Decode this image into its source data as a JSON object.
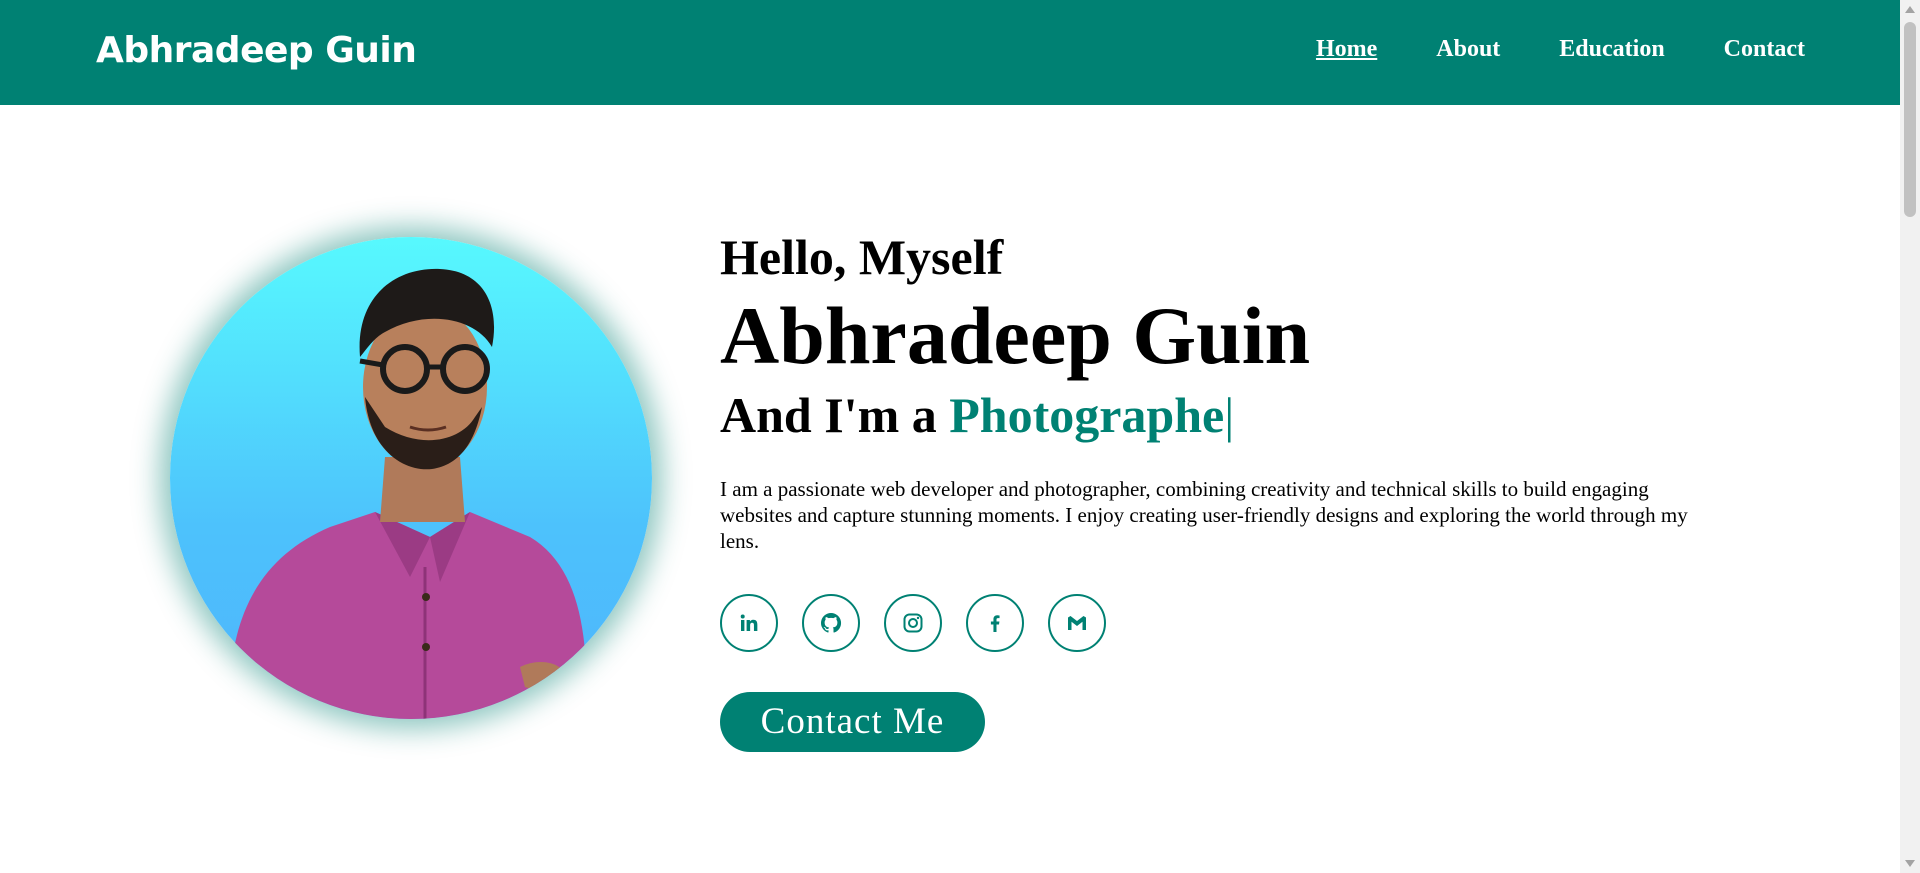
{
  "header": {
    "logo": "Abhradeep Guin",
    "nav": [
      {
        "label": "Home",
        "active": true
      },
      {
        "label": "About",
        "active": false
      },
      {
        "label": "Education",
        "active": false
      },
      {
        "label": "Contact",
        "active": false
      }
    ]
  },
  "hero": {
    "greeting": "Hello, Myself",
    "name": "Abhradeep Guin",
    "role_prefix": "And I'm a ",
    "role_typed": "Photographe",
    "caret": "|",
    "bio": "I am a passionate web developer and photographer, combining creativity and technical skills to build engaging websites and capture stunning moments. I enjoy creating user-friendly designs and exploring the world through my lens.",
    "socials": [
      "linkedin-icon",
      "github-icon",
      "instagram-icon",
      "facebook-icon",
      "gmail-icon"
    ],
    "contact_button": "Contact Me"
  },
  "colors": {
    "accent": "#008173",
    "avatar_gradient_top": "#57f9fe",
    "avatar_gradient_bottom": "#4eb4fd"
  }
}
